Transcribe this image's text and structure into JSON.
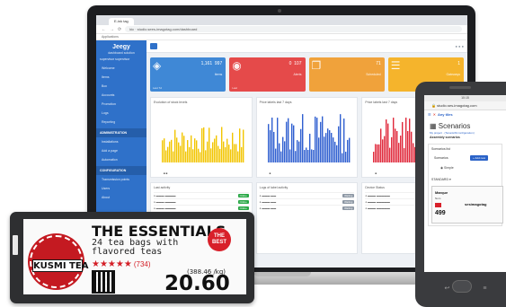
{
  "browser": {
    "tab_label": "E-ink tag",
    "url": "kic · studio.sees-imagotag.com/dashboard",
    "bookmarks": "Applications"
  },
  "dashboard": {
    "brand": "Jeegy",
    "brand_sub": "dashboard solution",
    "user": "supervisor supervisor",
    "side_items": [
      "Welcome",
      "Items",
      "Box",
      "Accounts",
      "Promotion",
      "Logs",
      "Reporting"
    ],
    "side_heads": [
      "ADMINISTRATION",
      "CONFIGURATION"
    ],
    "admin_items": [
      "Installations",
      "Add a page",
      "Automation"
    ],
    "config_items": [
      "Transmission points",
      "Users",
      "About"
    ],
    "cards": [
      {
        "num1": "1,161",
        "num2": "997",
        "lbl": "Items",
        "foot": "Last 7d"
      },
      {
        "num1": "0",
        "num2": "107",
        "lbl": "Alerts",
        "foot": "Last"
      },
      {
        "num1": "71",
        "num2": "",
        "lbl": "Scheduled",
        "foot": ""
      },
      {
        "num1": "1",
        "num2": "",
        "lbl": "Gateways",
        "foot": ""
      }
    ],
    "chart_titles": [
      "Evolution of stock levels",
      "Price labels last 7 days",
      "Price labels last 7 days"
    ],
    "table_titles": [
      "Last activity",
      "Logs of label activity",
      "Device Status"
    ],
    "tag_ok": "Online",
    "tag_grey": "Waiting"
  },
  "label": {
    "logo": "KUSMI TEA",
    "title": "THE ESSENTIALS",
    "desc": "24 tea bags with flavored teas",
    "best_line1": "THE",
    "best_line2": "BEST",
    "stars": "★★★★★",
    "review_count": "(734)",
    "unit_price": "(388.46 /kg)",
    "price": "20.60"
  },
  "phone": {
    "status": "10:15",
    "url": "studio.ses-imagotag.com",
    "nav_any": "Any tiles",
    "title": "Scenarios",
    "crumb": "My project · (Tenant/All configuration)",
    "sub": "Assembly scenarios",
    "card_head": "Scenarios list",
    "tabs": "Scenarios",
    "button": "+ Add new",
    "option": "Simple",
    "standard": "STANDARD",
    "brand": "Marque",
    "brand_sub": "Nom",
    "mini_price": "499",
    "mini_logo": "sesimagotag"
  },
  "colors": {
    "blue": "#3f88d6",
    "red": "#e54a4a",
    "orange": "#f0a23b",
    "yellow": "#f5b42c",
    "tag_red": "#d8202a"
  }
}
